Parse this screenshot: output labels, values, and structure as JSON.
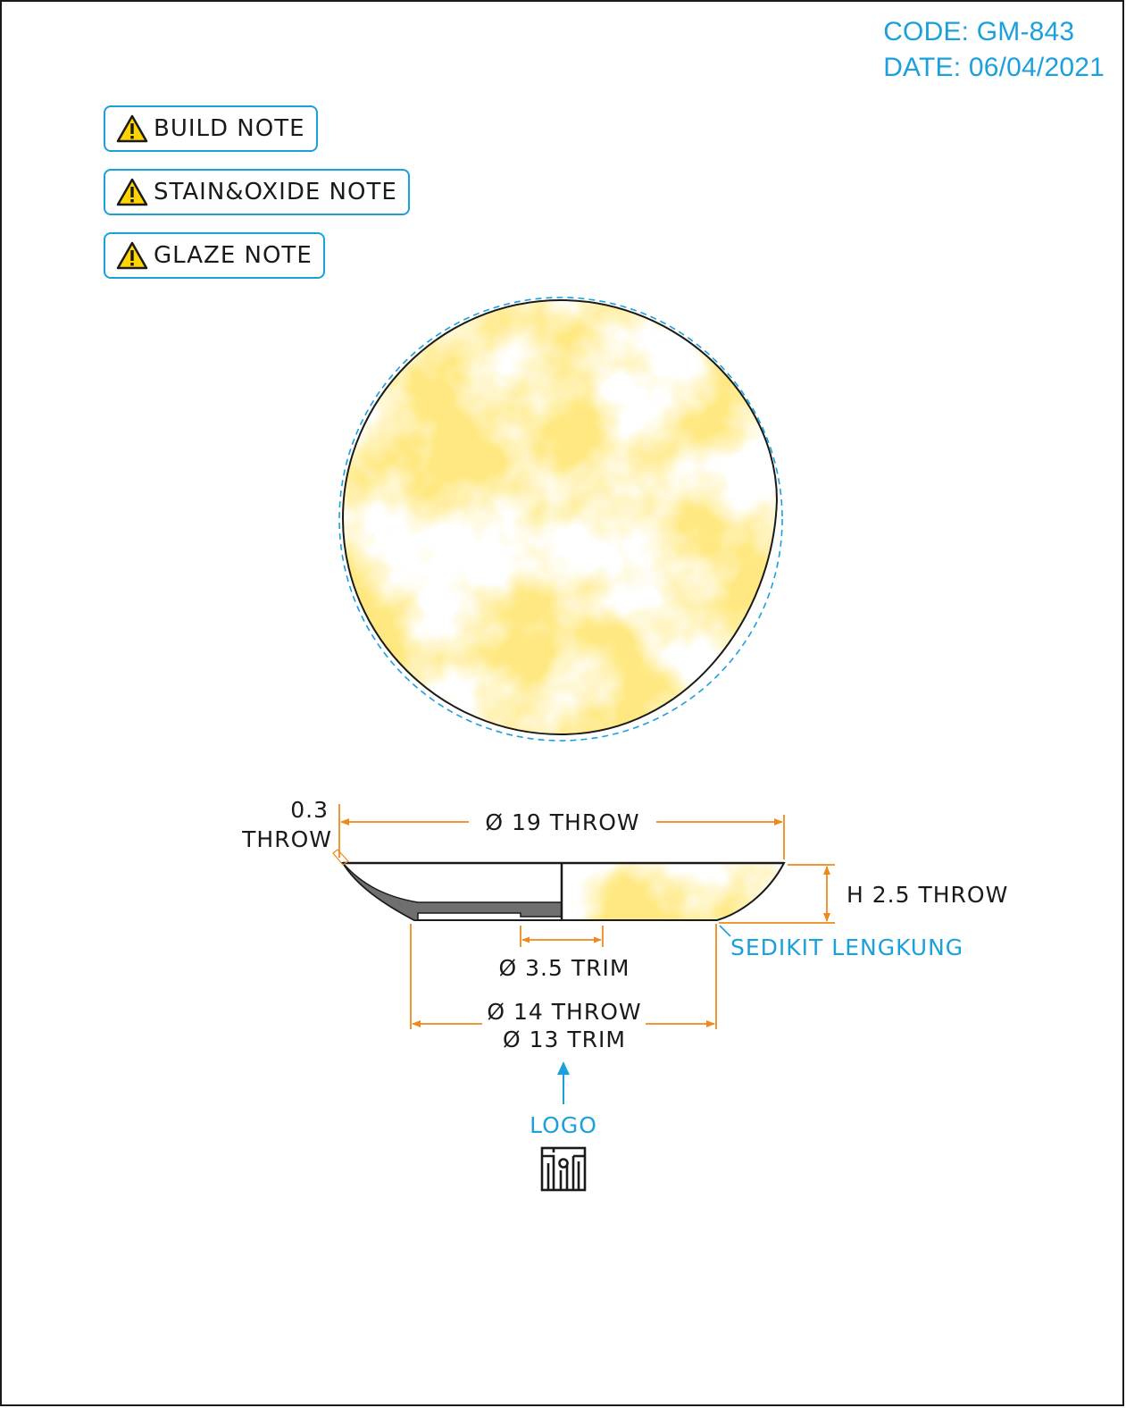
{
  "header": {
    "code": "CODE: GM-843",
    "date": "DATE: 06/04/2021"
  },
  "notes": {
    "build": "BUILD NOTE",
    "stain_oxide": "STAIN&OXIDE NOTE",
    "glaze": "GLAZE NOTE"
  },
  "dimensions": {
    "lip_1": "0.3",
    "lip_2": "THROW",
    "diameter_top": "Ø 19 THROW",
    "height": "H 2.5 THROW",
    "curve_note": "SEDIKIT LENGKUNG",
    "inner_trim": "Ø 3.5 TRIM",
    "base_throw": "Ø 14 THROW",
    "base_trim": "Ø 13 TRIM"
  },
  "logo": {
    "label": "LOGO"
  },
  "icons": {
    "warning": "warning-triangle-icon",
    "logo_mark": "maker-logo-icon"
  },
  "colors": {
    "accent_blue": "#1aa0dc",
    "dimension_orange": "#ee8a1c",
    "glaze_yellow": "#ffcf40",
    "outline": "#1a1a1a",
    "clay_gray": "#6f6f6f"
  }
}
